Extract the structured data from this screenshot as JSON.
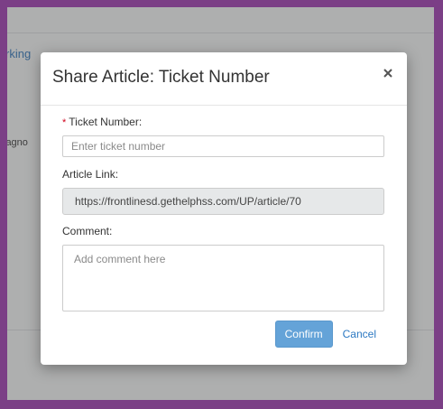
{
  "background": {
    "link_text": "rking",
    "side_text": "iagno"
  },
  "modal": {
    "title": "Share Article: Ticket Number",
    "required_marker": "*",
    "ticket_label": "Ticket Number:",
    "ticket_placeholder": "Enter ticket number",
    "ticket_value": "",
    "article_label": "Article Link:",
    "article_link": "https://frontlinesd.gethelphss.com/UP/article/70",
    "comment_label": "Comment:",
    "comment_placeholder": "Add comment here",
    "confirm_label": "Confirm",
    "cancel_label": "Cancel"
  },
  "colors": {
    "frame": "#7b3f86",
    "primary_button": "#64a3d8",
    "link": "#2b78c2",
    "required": "#d0021b"
  },
  "icons": {
    "close": "close-icon"
  }
}
